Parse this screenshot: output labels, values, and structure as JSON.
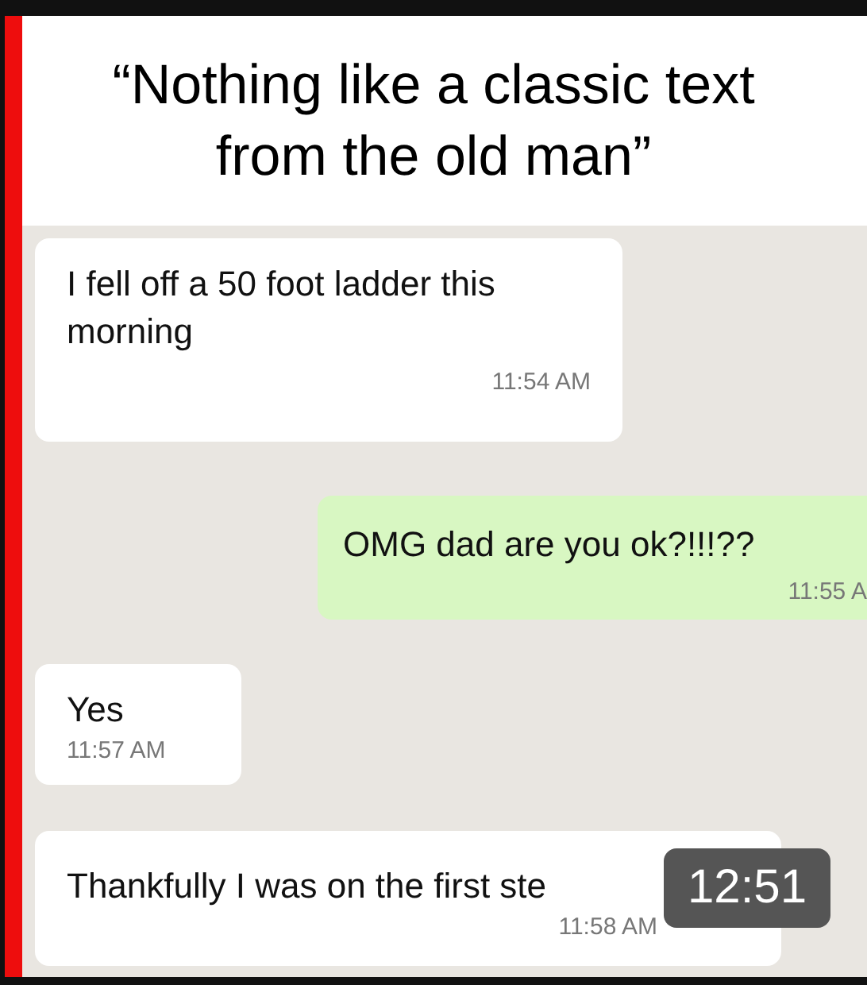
{
  "caption": "“Nothing like a classic text from the old man”",
  "messages": [
    {
      "kind": "received",
      "text": "I fell off a 50 foot ladder this morning",
      "time": "11:54 AM"
    },
    {
      "kind": "sent",
      "text": "OMG dad are you ok?!!!??",
      "time": "11:55 A"
    },
    {
      "kind": "received",
      "text": "Yes",
      "time": "11:57 AM"
    },
    {
      "kind": "received",
      "text": "Thankfully I was on the first ste",
      "time": "11:58 AM"
    }
  ],
  "video_duration": "12:51"
}
